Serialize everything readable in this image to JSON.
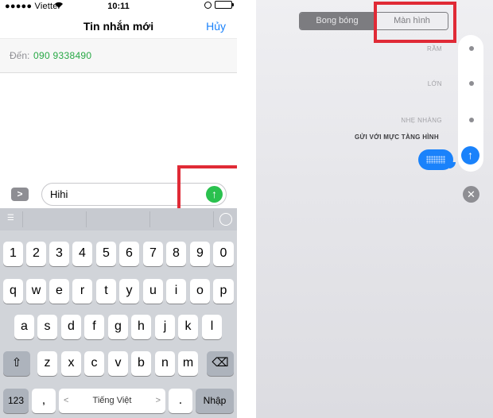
{
  "status_bar": {
    "carrier": "●●●●● Viettel",
    "time": "10:11"
  },
  "nav": {
    "title": "Tin nhắn mới",
    "cancel": "Hủy"
  },
  "to_field": {
    "label": "Đến:",
    "number": "090 9338490"
  },
  "composer": {
    "expand_glyph": ">",
    "message": "Hihi",
    "send_glyph": "↑"
  },
  "keyboard": {
    "row_numbers": [
      "1",
      "2",
      "3",
      "4",
      "5",
      "6",
      "7",
      "8",
      "9",
      "0"
    ],
    "row_top": [
      "q",
      "w",
      "e",
      "r",
      "t",
      "y",
      "u",
      "i",
      "o",
      "p"
    ],
    "row_middle": [
      "a",
      "s",
      "d",
      "f",
      "g",
      "h",
      "j",
      "k",
      "l"
    ],
    "row_bottom": [
      "z",
      "x",
      "c",
      "v",
      "b",
      "n",
      "m"
    ],
    "shift_glyph": "⇧",
    "delete_glyph": "⌫",
    "numbers_key": "123",
    "comma_key": ",",
    "space_key": "Tiếng Việt",
    "space_left": "<",
    "space_right": ">",
    "period_key": ".",
    "return_key": "Nhập"
  },
  "effects": {
    "tab_bubble": "Bong bóng",
    "tab_screen": "Màn hình",
    "slam": "RẦM",
    "loud": "LỚN",
    "gentle": "NHẸ NHÀNG",
    "invisible_ink": "GỬI VỚI MỰC TÀNG HÌNH",
    "send_glyph": "↑",
    "close_glyph": "✕"
  },
  "colors": {
    "accent_blue": "#1a82fb",
    "send_green": "#2ac14e",
    "highlight_red": "#e02a36"
  }
}
